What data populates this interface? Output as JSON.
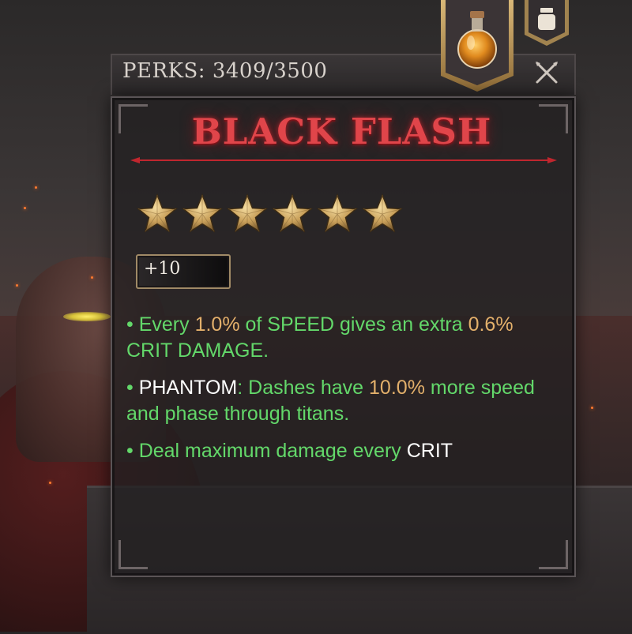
{
  "header": {
    "perks_label": "PERKS:",
    "perks_value": "3409/3500"
  },
  "perk": {
    "title": "BLACK FLASH",
    "stars": 6,
    "level_badge": "+10"
  },
  "descriptions": [
    {
      "parts": [
        {
          "text": "• Every ",
          "color": "green"
        },
        {
          "text": "1.0%",
          "color": "gold"
        },
        {
          "text": " of SPEED gives an extra ",
          "color": "green"
        },
        {
          "text": "0.6%",
          "color": "gold"
        },
        {
          "text": " CRIT DAMAGE.",
          "color": "green"
        }
      ]
    },
    {
      "parts": [
        {
          "text": "• ",
          "color": "green"
        },
        {
          "text": "PHANTOM",
          "color": "white"
        },
        {
          "text": ": Dashes have ",
          "color": "green"
        },
        {
          "text": "10.0%",
          "color": "gold"
        },
        {
          "text": " more speed and phase through titans.",
          "color": "green"
        }
      ]
    },
    {
      "parts": [
        {
          "text": "• Deal maximum damage every ",
          "color": "green"
        },
        {
          "text": "CRIT",
          "color": "white"
        }
      ]
    }
  ],
  "icons": {
    "potion": "potion-icon",
    "jar": "jar-icon",
    "close": "close-icon",
    "star": "star-icon"
  },
  "colors": {
    "title_red": "#e0454a",
    "text_green": "#63d86a",
    "value_gold": "#e3b06b",
    "star_gold": "#c9a05a"
  }
}
